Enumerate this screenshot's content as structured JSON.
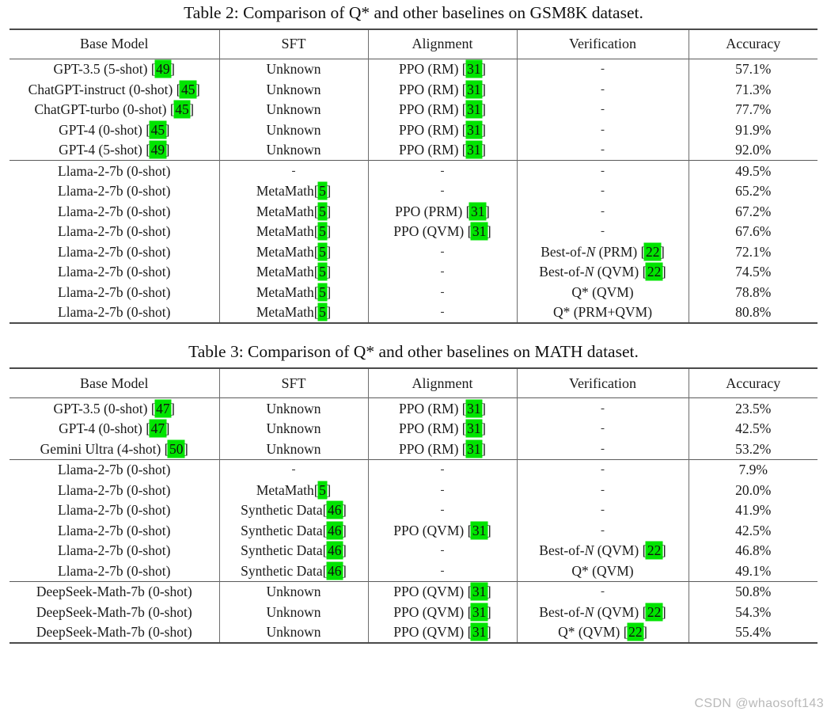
{
  "watermark": "CSDN @whaosoft143",
  "tables": [
    {
      "caption": "Table 2: Comparison of Q* and other baselines on GSM8K dataset.",
      "columns": [
        "Base Model",
        "SFT",
        "Alignment",
        "Verification",
        "Accuracy"
      ],
      "groups": [
        {
          "rows": [
            {
              "model": "GPT-3.5 (5-shot)",
              "model_cite": "49",
              "sft": "Unknown",
              "sft_cite": "",
              "alignment": "PPO (RM)",
              "alignment_cite": "31",
              "verification": "-",
              "verification_cite": "",
              "accuracy": "57.1%",
              "bold": false
            },
            {
              "model": "ChatGPT-instruct (0-shot)",
              "model_cite": "45",
              "sft": "Unknown",
              "sft_cite": "",
              "alignment": "PPO (RM)",
              "alignment_cite": "31",
              "verification": "-",
              "verification_cite": "",
              "accuracy": "71.3%",
              "bold": false
            },
            {
              "model": "ChatGPT-turbo (0-shot)",
              "model_cite": "45",
              "sft": "Unknown",
              "sft_cite": "",
              "alignment": "PPO (RM)",
              "alignment_cite": "31",
              "verification": "-",
              "verification_cite": "",
              "accuracy": "77.7%",
              "bold": false
            },
            {
              "model": "GPT-4 (0-shot)",
              "model_cite": "45",
              "sft": "Unknown",
              "sft_cite": "",
              "alignment": "PPO (RM)",
              "alignment_cite": "31",
              "verification": "-",
              "verification_cite": "",
              "accuracy": "91.9%",
              "bold": false
            },
            {
              "model": "GPT-4 (5-shot)",
              "model_cite": "49",
              "sft": "Unknown",
              "sft_cite": "",
              "alignment": "PPO (RM)",
              "alignment_cite": "31",
              "verification": "-",
              "verification_cite": "",
              "accuracy": "92.0%",
              "bold": true
            }
          ]
        },
        {
          "rows": [
            {
              "model": "Llama-2-7b (0-shot)",
              "model_cite": "",
              "sft": "-",
              "sft_cite": "",
              "alignment": "-",
              "alignment_cite": "",
              "verification": "-",
              "verification_cite": "",
              "accuracy": "49.5%",
              "bold": false
            },
            {
              "model": "Llama-2-7b (0-shot)",
              "model_cite": "",
              "sft": "MetaMath",
              "sft_cite": "5",
              "sft_nospace": true,
              "alignment": "-",
              "alignment_cite": "",
              "verification": "-",
              "verification_cite": "",
              "accuracy": "65.2%",
              "bold": false
            },
            {
              "model": "Llama-2-7b (0-shot)",
              "model_cite": "",
              "sft": "MetaMath",
              "sft_cite": "5",
              "sft_nospace": true,
              "alignment": "PPO (PRM)",
              "alignment_cite": "31",
              "verification": "-",
              "verification_cite": "",
              "accuracy": "67.2%",
              "bold": false
            },
            {
              "model": "Llama-2-7b (0-shot)",
              "model_cite": "",
              "sft": "MetaMath",
              "sft_cite": "5",
              "sft_nospace": true,
              "alignment": "PPO (QVM)",
              "alignment_cite": "31",
              "verification": "-",
              "verification_cite": "",
              "accuracy": "67.6%",
              "bold": false
            },
            {
              "model": "Llama-2-7b (0-shot)",
              "model_cite": "",
              "sft": "MetaMath",
              "sft_cite": "5",
              "sft_nospace": true,
              "alignment": "-",
              "alignment_cite": "",
              "verification": "Best-of-N (PRM)",
              "verification_italic_n": true,
              "verification_cite": "22",
              "accuracy": "72.1%",
              "bold": false
            },
            {
              "model": "Llama-2-7b (0-shot)",
              "model_cite": "",
              "sft": "MetaMath",
              "sft_cite": "5",
              "sft_nospace": true,
              "alignment": "-",
              "alignment_cite": "",
              "verification": "Best-of-N (QVM)",
              "verification_italic_n": true,
              "verification_cite": "22",
              "accuracy": "74.5%",
              "bold": false
            },
            {
              "model": "Llama-2-7b (0-shot)",
              "model_cite": "",
              "sft": "MetaMath",
              "sft_cite": "5",
              "sft_nospace": true,
              "alignment": "-",
              "alignment_cite": "",
              "verification": "Q* (QVM)",
              "verification_cite": "",
              "accuracy": "78.8%",
              "bold": false
            },
            {
              "model": "Llama-2-7b (0-shot)",
              "model_cite": "",
              "sft": "MetaMath",
              "sft_cite": "5",
              "sft_nospace": true,
              "alignment": "-",
              "alignment_cite": "",
              "verification": "Q* (PRM+QVM)",
              "verification_cite": "",
              "accuracy": "80.8%",
              "bold": true
            }
          ]
        }
      ]
    },
    {
      "caption": "Table 3: Comparison of Q* and other baselines on MATH dataset.",
      "columns": [
        "Base Model",
        "SFT",
        "Alignment",
        "Verification",
        "Accuracy"
      ],
      "groups": [
        {
          "rows": [
            {
              "model": "GPT-3.5 (0-shot)",
              "model_cite": "47",
              "sft": "Unknown",
              "sft_cite": "",
              "alignment": "PPO (RM)",
              "alignment_cite": "31",
              "verification": "-",
              "verification_cite": "",
              "accuracy": "23.5%",
              "bold": false
            },
            {
              "model": "GPT-4 (0-shot)",
              "model_cite": "47",
              "sft": "Unknown",
              "sft_cite": "",
              "alignment": "PPO (RM)",
              "alignment_cite": "31",
              "verification": "-",
              "verification_cite": "",
              "accuracy": "42.5%",
              "bold": false
            },
            {
              "model": "Gemini Ultra (4-shot)",
              "model_cite": "50",
              "sft": "Unknown",
              "sft_cite": "",
              "alignment": "PPO (RM)",
              "alignment_cite": "31",
              "verification": "-",
              "verification_cite": "",
              "accuracy": "53.2%",
              "bold": true
            }
          ]
        },
        {
          "rows": [
            {
              "model": "Llama-2-7b (0-shot)",
              "model_cite": "",
              "sft": "-",
              "sft_cite": "",
              "alignment": "-",
              "alignment_cite": "",
              "verification": "-",
              "verification_cite": "",
              "accuracy": "7.9%",
              "bold": false
            },
            {
              "model": "Llama-2-7b (0-shot)",
              "model_cite": "",
              "sft": "MetaMath",
              "sft_cite": "5",
              "sft_nospace": true,
              "alignment": "-",
              "alignment_cite": "",
              "verification": "-",
              "verification_cite": "",
              "accuracy": "20.0%",
              "bold": false
            },
            {
              "model": "Llama-2-7b (0-shot)",
              "model_cite": "",
              "sft": "Synthetic Data",
              "sft_cite": "46",
              "sft_nospace": true,
              "alignment": "-",
              "alignment_cite": "",
              "verification": "-",
              "verification_cite": "",
              "accuracy": "41.9%",
              "bold": false
            },
            {
              "model": "Llama-2-7b (0-shot)",
              "model_cite": "",
              "sft": "Synthetic Data",
              "sft_cite": "46",
              "sft_nospace": true,
              "alignment": "PPO (QVM)",
              "alignment_cite": "31",
              "verification": "-",
              "verification_cite": "",
              "accuracy": "42.5%",
              "bold": false
            },
            {
              "model": "Llama-2-7b (0-shot)",
              "model_cite": "",
              "sft": "Synthetic Data",
              "sft_cite": "46",
              "sft_nospace": true,
              "alignment": "-",
              "alignment_cite": "",
              "verification": "Best-of-N (QVM)",
              "verification_italic_n": true,
              "verification_cite": "22",
              "accuracy": "46.8%",
              "bold": false
            },
            {
              "model": "Llama-2-7b (0-shot)",
              "model_cite": "",
              "sft": "Synthetic Data",
              "sft_cite": "46",
              "sft_nospace": true,
              "alignment": "-",
              "alignment_cite": "",
              "verification": "Q* (QVM)",
              "verification_cite": "",
              "accuracy": "49.1%",
              "bold": true
            }
          ]
        },
        {
          "rows": [
            {
              "model": "DeepSeek-Math-7b (0-shot)",
              "model_cite": "",
              "sft": "Unknown",
              "sft_cite": "",
              "alignment": "PPO (QVM)",
              "alignment_cite": "31",
              "verification": "-",
              "verification_cite": "",
              "accuracy": "50.8%",
              "bold": false
            },
            {
              "model": "DeepSeek-Math-7b (0-shot)",
              "model_cite": "",
              "sft": "Unknown",
              "sft_cite": "",
              "alignment": "PPO (QVM)",
              "alignment_cite": "31",
              "verification": "Best-of-N (QVM)",
              "verification_italic_n": true,
              "verification_cite": "22",
              "accuracy": "54.3%",
              "bold": false
            },
            {
              "model": "DeepSeek-Math-7b (0-shot)",
              "model_cite": "",
              "sft": "Unknown",
              "sft_cite": "",
              "alignment": "PPO (QVM)",
              "alignment_cite": "31",
              "verification": "Q* (QVM)",
              "verification_cite": "22",
              "accuracy": "55.4%",
              "bold": true
            }
          ]
        }
      ]
    }
  ]
}
